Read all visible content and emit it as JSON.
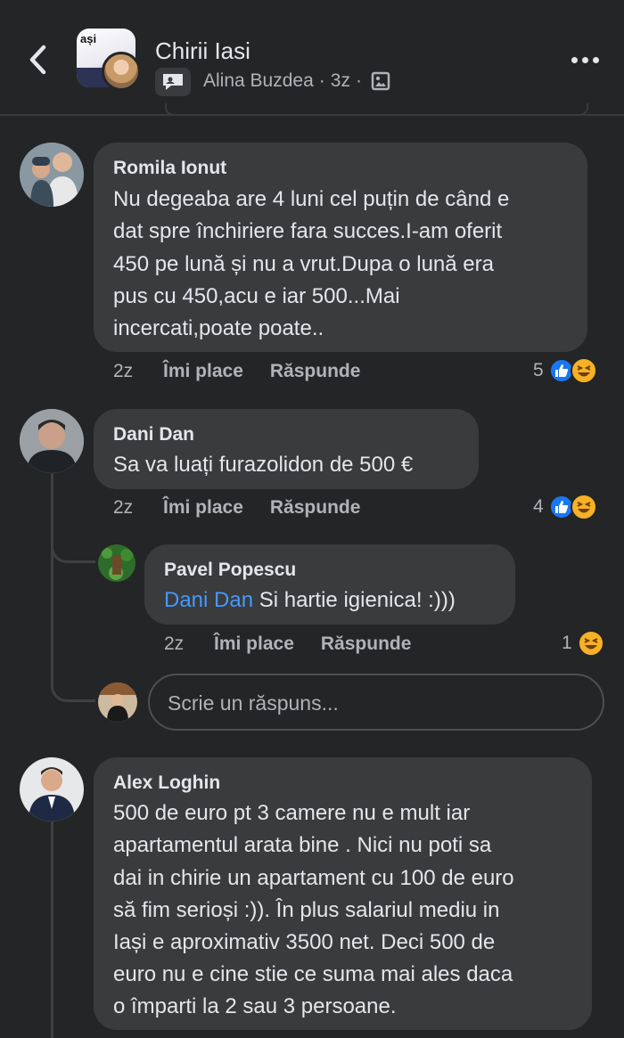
{
  "header": {
    "group_thumb_text": "ași",
    "title": "Chirii Iasi",
    "author": "Alina Buzdea",
    "separator": "·",
    "time": "3z"
  },
  "comments": [
    {
      "author": "Romila Ionut",
      "lines": [
        "Nu degeaba are 4 luni cel puțin de când e",
        "dat spre închiriere fara succes.I-am oferit",
        "450 pe lună și nu a vrut.Dupa o lună era",
        "pus cu 450,acu e iar 500...Mai",
        "incercati,poate poate.."
      ],
      "time": "2z",
      "like_label": "Îmi place",
      "reply_label": "Răspunde",
      "reaction_count": "5",
      "reactions": [
        "like-icon",
        "haha-icon"
      ]
    },
    {
      "author": "Dani Dan",
      "text": "Sa va luați furazolidon de 500 €",
      "time": "2z",
      "like_label": "Îmi place",
      "reply_label": "Răspunde",
      "reaction_count": "4",
      "reactions": [
        "like-icon",
        "haha-icon"
      ],
      "reply": {
        "author": "Pavel Popescu",
        "mention": "Dani Dan",
        "text": " Si hartie igienica! :)))",
        "time": "2z",
        "like_label": "Îmi place",
        "reply_label": "Răspunde",
        "reaction_count": "1",
        "reactions": [
          "haha-icon"
        ]
      },
      "reply_placeholder": "Scrie un răspuns..."
    },
    {
      "author": "Alex Loghin",
      "lines": [
        "500 de euro pt 3 camere nu e mult iar",
        "apartamentul arata bine . Nici nu poti sa",
        "dai in chirie un apartament cu 100 de euro",
        "să fim serioși  :)). În plus salariul mediu in",
        "Iași e aproximativ 3500 net. Deci 500 de",
        "euro nu e cine stie ce suma mai ales daca",
        "o împarti la 2 sau 3 persoane."
      ]
    }
  ],
  "colors": {
    "background": "#242526",
    "bubble": "#3a3b3c",
    "mention": "#4599ff",
    "like_blue": "#1877f2",
    "haha_yellow": "#f7b125"
  }
}
